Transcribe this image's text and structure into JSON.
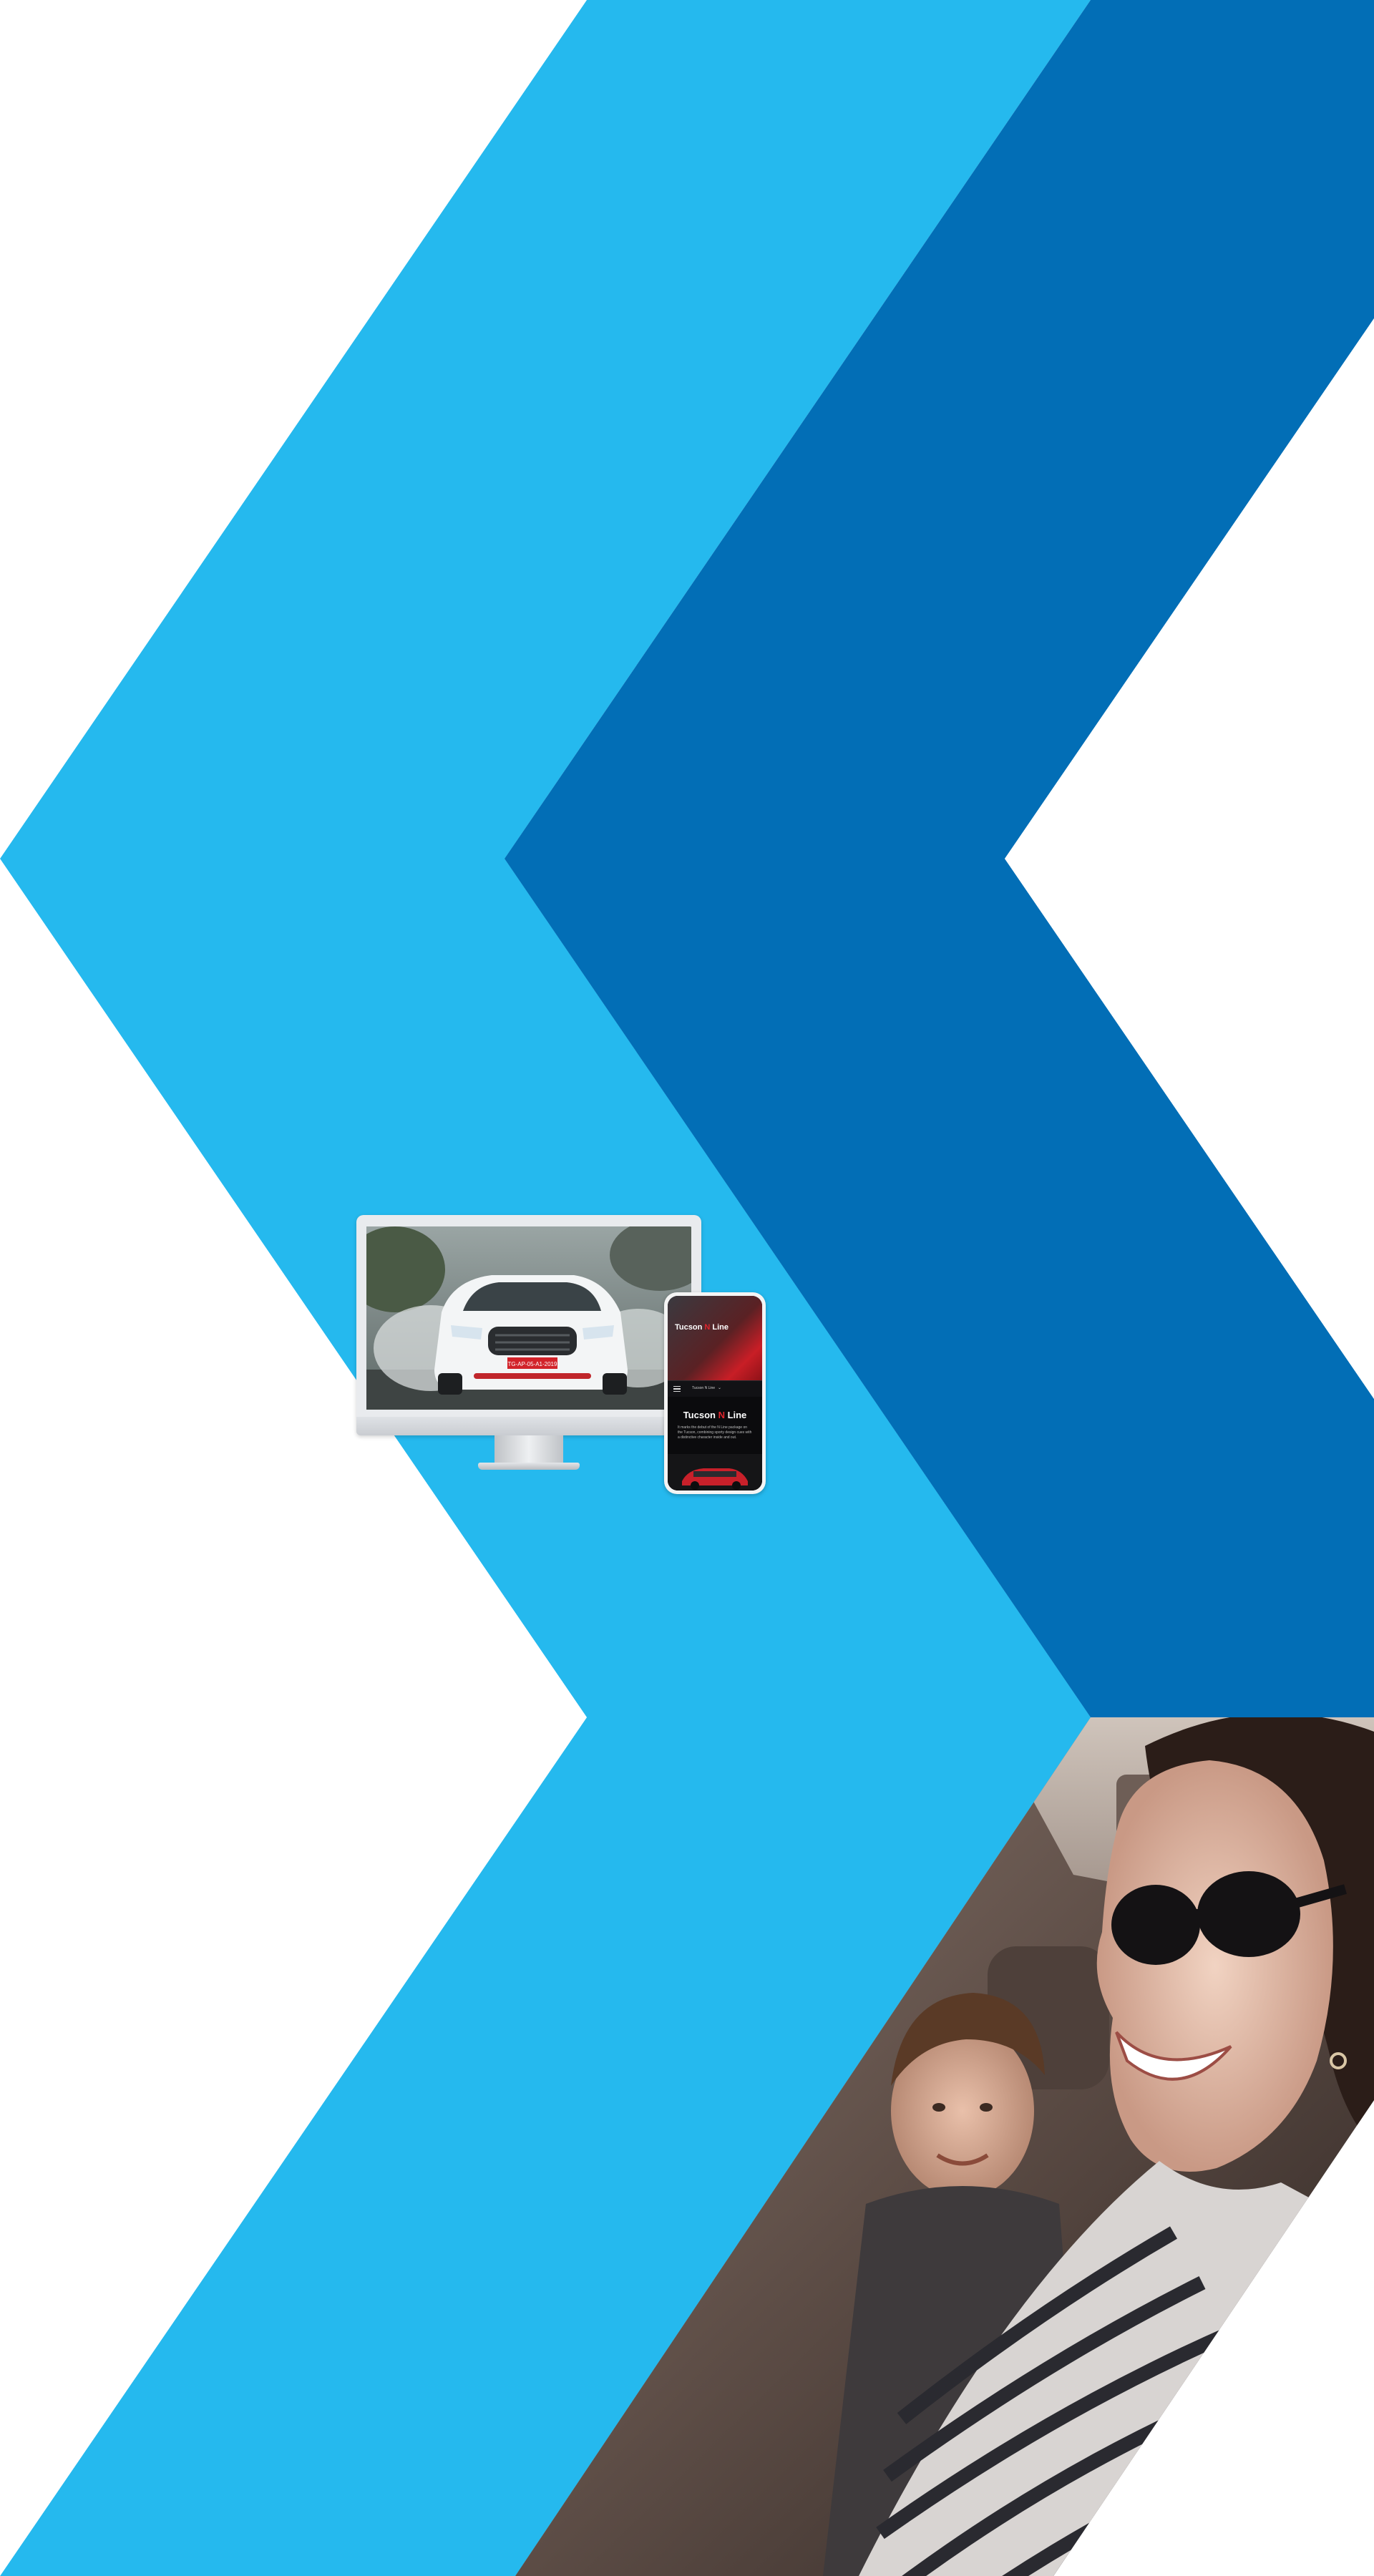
{
  "colors": {
    "light_blue": "#25b9ee",
    "dark_blue": "#026eb6",
    "background": "#ffffff",
    "phone_accent": "#e0242c"
  },
  "desktop_mockup": {
    "plate_text": "TG-AP-05-A1-2019"
  },
  "phone_mockup": {
    "hero_title_part1": "Tucson ",
    "hero_title_accent": "N",
    "hero_title_part2": " Line",
    "nav_label": "Tucson N Line",
    "nav_chevron": "⌄",
    "body_title_part1": "Tucson ",
    "body_title_accent": "N",
    "body_title_part2": " Line",
    "body_text": "It marks the debut of the N Line package on the Tucson, combining sporty design cues with a distinctive character inside and out."
  },
  "photo": {
    "subject": "smiling woman in sunglasses driving with a boy in the back seat"
  }
}
